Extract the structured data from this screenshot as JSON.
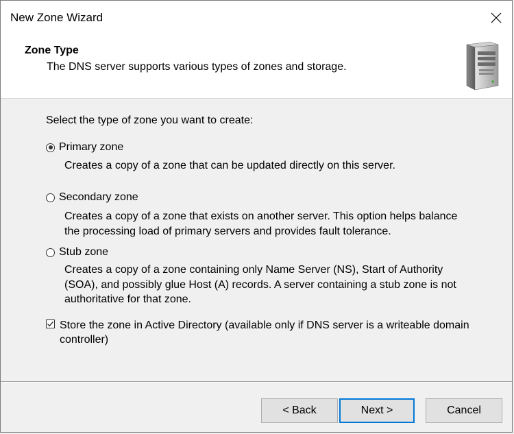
{
  "window": {
    "title": "New Zone Wizard"
  },
  "header": {
    "title": "Zone Type",
    "subtitle": "The DNS server supports various types of zones and storage."
  },
  "content": {
    "prompt": "Select the type of zone you want to create:",
    "options": [
      {
        "label": "Primary zone",
        "selected": true,
        "desc_lines": [
          "Creates a copy of a zone that can be updated directly on this server."
        ]
      },
      {
        "label": "Secondary zone",
        "selected": false,
        "desc_lines": [
          "Creates a copy of a zone that exists on another server. This option helps balance",
          "the processing load of primary servers and provides fault tolerance."
        ]
      },
      {
        "label": "Stub zone",
        "selected": false,
        "desc_lines": [
          "Creates a copy of a zone containing only Name Server (NS), Start of Authority",
          "(SOA), and possibly glue Host (A) records. A server containing a stub zone is not",
          "authoritative for that zone."
        ]
      }
    ],
    "ad_checkbox": {
      "checked": true,
      "label_lines": [
        "Store the zone in Active Directory (available only if DNS server is a writeable domain",
        "controller)"
      ]
    }
  },
  "buttons": {
    "back": "< Back",
    "next": "Next >",
    "cancel": "Cancel"
  },
  "icons": {
    "close": "close-icon",
    "server": "server-icon"
  }
}
